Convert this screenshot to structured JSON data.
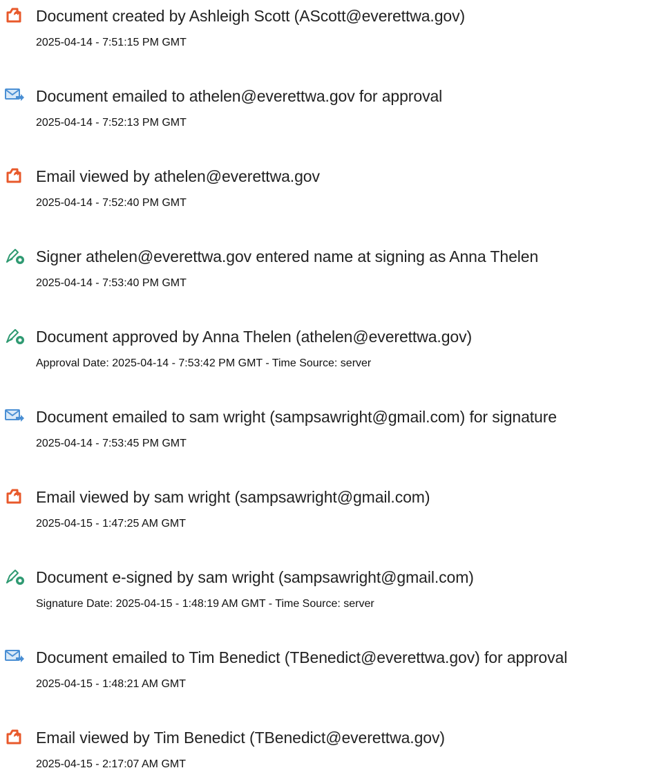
{
  "colors": {
    "pdf_icon": "#e8592b",
    "email_icon": "#4a8fd4",
    "sign_icon": "#2f9a72"
  },
  "events": [
    {
      "icon": "pdf-document-icon",
      "title": "Document created by Ashleigh Scott (AScott@everettwa.gov)",
      "detail": "2025-04-14 - 7:51:15 PM GMT"
    },
    {
      "icon": "email-send-icon",
      "title": "Document emailed to athelen@everettwa.gov for approval",
      "detail": "2025-04-14 - 7:52:13 PM GMT"
    },
    {
      "icon": "pdf-document-icon",
      "title": "Email viewed by athelen@everettwa.gov",
      "detail": "2025-04-14 - 7:52:40 PM GMT"
    },
    {
      "icon": "pen-sign-icon",
      "title": "Signer athelen@everettwa.gov entered name at signing as Anna Thelen",
      "detail": "2025-04-14 - 7:53:40 PM GMT"
    },
    {
      "icon": "pen-sign-icon",
      "title": "Document approved by Anna Thelen (athelen@everettwa.gov)",
      "detail": "Approval Date: 2025-04-14 - 7:53:42 PM GMT - Time Source: server"
    },
    {
      "icon": "email-send-icon",
      "title": "Document emailed to sam wright (sampsawright@gmail.com) for signature",
      "detail": "2025-04-14 - 7:53:45 PM GMT"
    },
    {
      "icon": "pdf-document-icon",
      "title": "Email viewed by sam wright (sampsawright@gmail.com)",
      "detail": "2025-04-15 - 1:47:25 AM GMT"
    },
    {
      "icon": "pen-sign-icon",
      "title": "Document e-signed by sam wright (sampsawright@gmail.com)",
      "detail": "Signature Date: 2025-04-15 - 1:48:19 AM GMT - Time Source: server"
    },
    {
      "icon": "email-send-icon",
      "title": "Document emailed to Tim Benedict (TBenedict@everettwa.gov) for approval",
      "detail": "2025-04-15 - 1:48:21 AM GMT"
    },
    {
      "icon": "pdf-document-icon",
      "title": "Email viewed by Tim Benedict (TBenedict@everettwa.gov)",
      "detail": "2025-04-15 - 2:17:07 AM GMT"
    }
  ]
}
